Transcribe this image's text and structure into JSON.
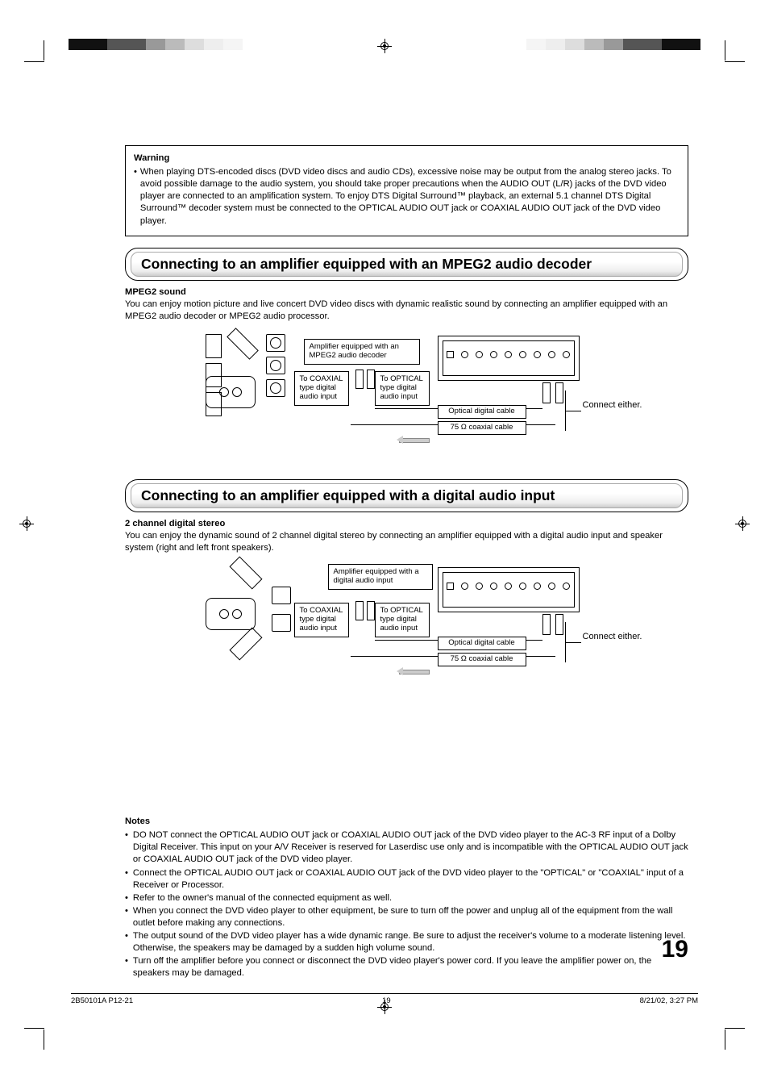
{
  "warning": {
    "title": "Warning",
    "text": "When playing DTS-encoded discs (DVD video discs and audio CDs), excessive noise may be output from the analog stereo jacks.  To avoid possible damage to the audio system, you should take proper precautions when the AUDIO OUT (L/R) jacks of the DVD video player are connected to an amplification system.  To enjoy DTS Digital Surround™ playback, an external 5.1 channel DTS Digital Surround™ decoder system must be connected to the OPTICAL AUDIO OUT jack or COAXIAL AUDIO OUT jack of the DVD video player."
  },
  "section1": {
    "heading": "Connecting to an amplifier equipped with an MPEG2 audio decoder",
    "sub": "MPEG2 sound",
    "body": "You can enjoy motion picture and live concert DVD video discs with dynamic realistic sound by connecting an amplifier equipped with an MPEG2 audio decoder or MPEG2 audio processor.",
    "diagram": {
      "amp_label": "Amplifier equipped with an MPEG2 audio decoder",
      "coax_label": "To COAXIAL type digital audio input",
      "opt_label": "To OPTICAL type digital audio input",
      "cable_opt": "Optical digital cable",
      "cable_coax": "75 Ω coaxial cable",
      "connect": "Connect either."
    }
  },
  "section2": {
    "heading": "Connecting to an amplifier equipped with a digital audio input",
    "sub": "2 channel digital stereo",
    "body": "You can enjoy the dynamic sound of 2 channel digital stereo by connecting an amplifier equipped with a digital audio input and speaker system (right and left front speakers).",
    "diagram": {
      "amp_label": "Amplifier equipped with a digital audio input",
      "coax_label": "To COAXIAL type digital audio input",
      "opt_label": "To OPTICAL type digital audio input",
      "cable_opt": "Optical digital cable",
      "cable_coax": "75 Ω coaxial cable",
      "connect": "Connect either."
    }
  },
  "notes": {
    "title": "Notes",
    "items": [
      "DO NOT connect the OPTICAL AUDIO OUT jack or COAXIAL AUDIO OUT jack of the DVD video player to the AC-3 RF input of a Dolby Digital Receiver.  This input on your A/V Receiver is reserved for Laserdisc use only and is incompatible with the OPTICAL AUDIO OUT jack or COAXIAL AUDIO OUT jack of the DVD video player.",
      "Connect the OPTICAL AUDIO OUT jack or COAXIAL AUDIO OUT jack of the DVD video player to the \"OPTICAL\" or \"COAXIAL\" input of a Receiver or Processor.",
      "Refer to the owner's manual of the connected equipment as well.",
      "When you connect the DVD video player to other equipment, be sure to turn off the power and unplug all of the equipment from the wall outlet before making any connections.",
      "The output sound of the DVD video player has a wide dynamic range. Be sure to adjust the receiver's volume to a moderate listening level. Otherwise, the speakers may be damaged by a sudden high volume sound.",
      "Turn off the amplifier before you connect or disconnect the DVD video player's power cord. If you leave the amplifier power on, the speakers may be damaged."
    ]
  },
  "page_number": "19",
  "footer": {
    "left": "2B50101A P12-21",
    "center": "19",
    "right": "8/21/02, 3:27 PM"
  }
}
